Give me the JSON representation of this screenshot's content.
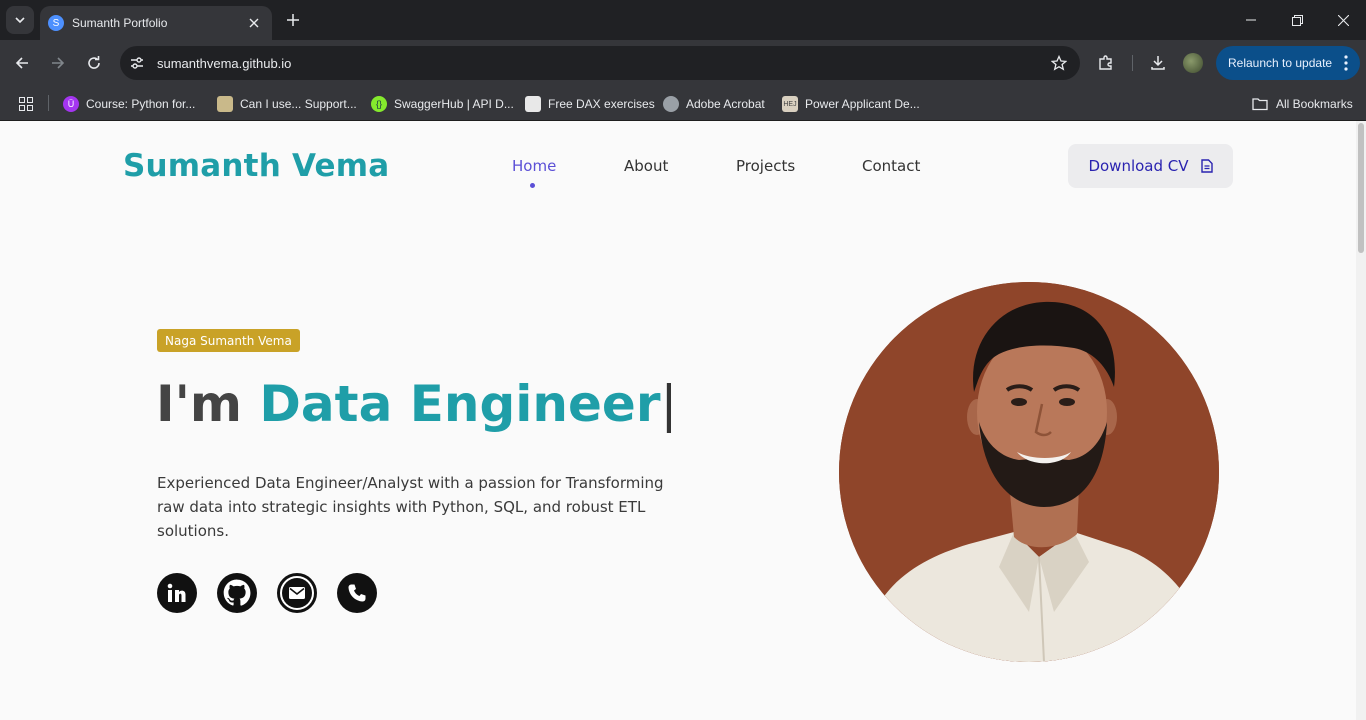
{
  "browser": {
    "tab_title": "Sumanth Portfolio",
    "tab_favicon_letter": "S",
    "url": "sumanthvema.github.io",
    "relaunch_label": "Relaunch to update",
    "bookmarks": [
      {
        "label": "Course: Python for...",
        "icon": "udemy-icon",
        "color": "#a435f0"
      },
      {
        "label": "Can I use... Support...",
        "icon": "caniuse-icon",
        "color": "#c9b98a"
      },
      {
        "label": "SwaggerHub | API D...",
        "icon": "swagger-icon",
        "color": "#85ea2d"
      },
      {
        "label": "Free DAX exercises",
        "icon": "dax-icon",
        "color": "#e8e8e8"
      },
      {
        "label": "Adobe Acrobat",
        "icon": "globe-icon",
        "color": "#9aa0a6"
      },
      {
        "label": "Power Applicant De...",
        "icon": "hej-icon",
        "color": "#d9d0c0"
      }
    ],
    "all_bookmarks_label": "All Bookmarks"
  },
  "site": {
    "logo": "Sumanth Vema",
    "nav": {
      "home": "Home",
      "about": "About",
      "projects": "Projects",
      "contact": "Contact"
    },
    "download_cv": "Download CV",
    "hero": {
      "badge": "Naga Sumanth Vema",
      "headline_prefix": "I'm ",
      "headline_role": "Data Engineer",
      "cursor": "|",
      "intro": "Experienced Data Engineer/Analyst with a passion for Transforming raw data into strategic insights with Python, SQL, and robust ETL solutions."
    },
    "socials": [
      "linkedin-icon",
      "github-icon",
      "mail-icon",
      "phone-icon"
    ]
  },
  "colors": {
    "brand_teal": "#1f9ea8",
    "nav_active": "#5b4fd6",
    "badge_gold": "#c9a227",
    "portrait_bg": "#8f452a"
  }
}
